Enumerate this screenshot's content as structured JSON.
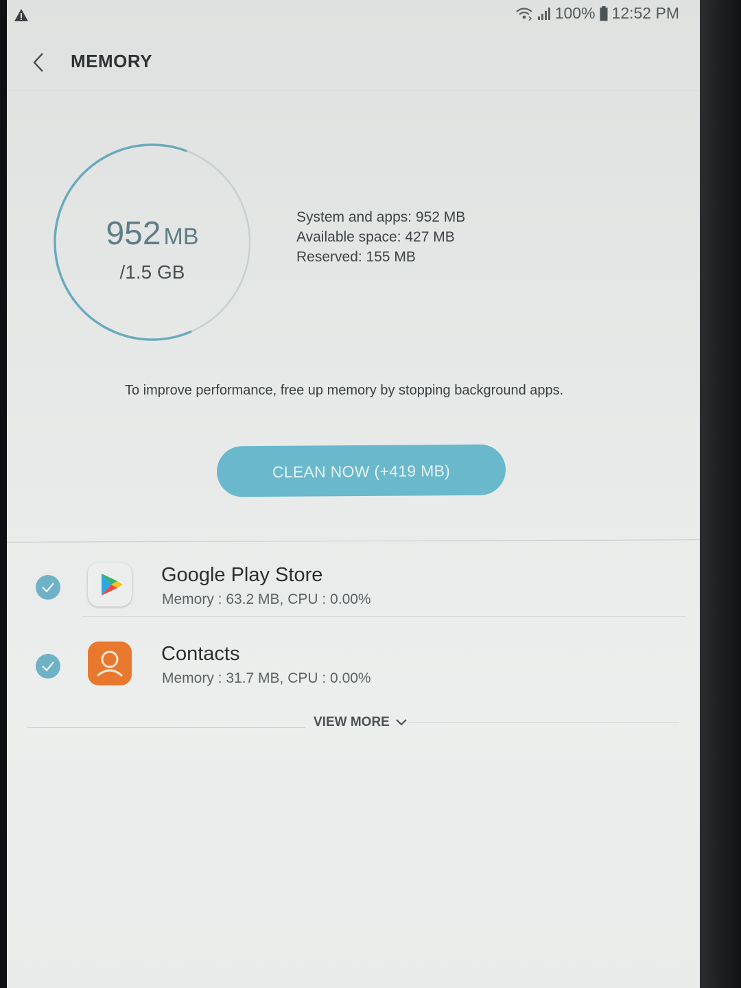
{
  "status_bar": {
    "warning_icon": "warning-triangle-icon",
    "wifi_icon": "wifi-icon",
    "signal_icon": "cell-signal-icon",
    "battery_percent": "100%",
    "battery_icon": "battery-icon",
    "time": "12:52 PM"
  },
  "header": {
    "back_icon": "chevron-left-icon",
    "title": "MEMORY"
  },
  "gauge": {
    "used_value": "952",
    "used_unit": "MB",
    "total": "/1.5 GB",
    "fill_fraction": 0.62,
    "ring_color": "#6aaabc"
  },
  "stats": {
    "system_and_apps": "System and apps: 952 MB",
    "available_space": "Available space: 427 MB",
    "reserved": "Reserved: 155 MB"
  },
  "hint": "To improve performance, free up memory by stopping background apps.",
  "clean_button": "CLEAN NOW (+419 MB)",
  "apps": [
    {
      "name": "Google Play Store",
      "usage": "Memory : 63.2 MB, CPU : 0.00%",
      "icon": "google-play-store-icon",
      "checked": true
    },
    {
      "name": "Contacts",
      "usage": "Memory : 31.7 MB, CPU : 0.00%",
      "icon": "contacts-icon",
      "checked": true
    }
  ],
  "view_more": "VIEW MORE",
  "colors": {
    "accent": "#69b8cc",
    "check": "#6fb1c7",
    "contacts_orange": "#e8782e"
  }
}
